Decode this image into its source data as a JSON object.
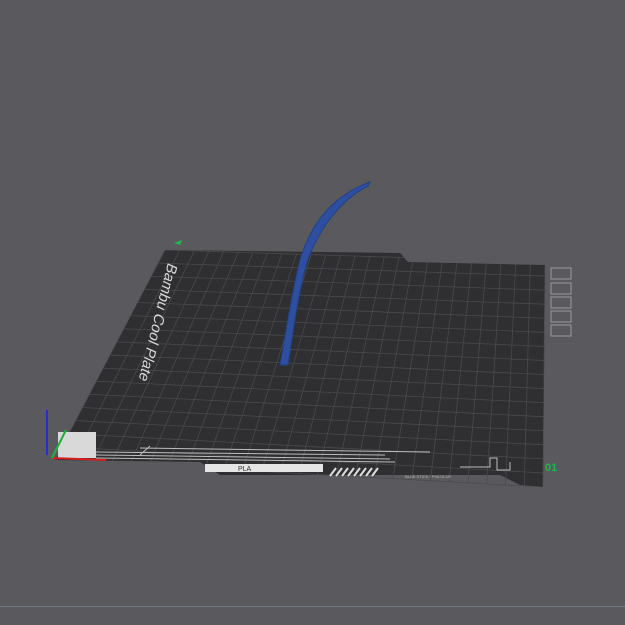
{
  "plate": {
    "name": "Bambu Cool Plate",
    "material": "PLA",
    "plate_number": "01",
    "sticker_text": "BLUE STICK / PVA GLUE"
  },
  "grid": {
    "cols": 26,
    "rows": 16
  },
  "colors": {
    "background": "#5a5a5e",
    "plate": "#2f2f31",
    "grid": "#4a4a4e",
    "model": "#2e4fa0",
    "plate_label": "#1fb84a",
    "axis_x": "#d42020",
    "axis_y": "#20b040",
    "axis_z": "#2030d0"
  }
}
